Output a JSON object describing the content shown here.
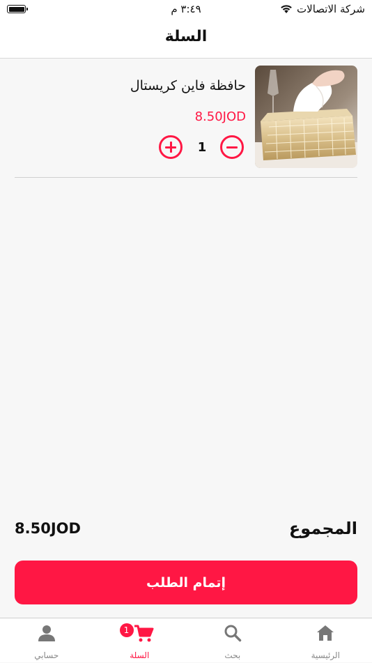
{
  "status_bar": {
    "carrier": "شركة الاتصالات",
    "time": "٣:٤٩ م"
  },
  "header": {
    "title": "السلة"
  },
  "cart": {
    "items": [
      {
        "name": "حافظة فاين كريستال",
        "price": "8.50JOD",
        "quantity": "1"
      }
    ]
  },
  "summary": {
    "total_label": "المجموع",
    "total_value": "8.50JOD"
  },
  "checkout": {
    "label": "إتمام الطلب"
  },
  "tab_bar": {
    "items": [
      {
        "label": "الرئيسية",
        "icon": "home-icon"
      },
      {
        "label": "بحث",
        "icon": "search-icon"
      },
      {
        "label": "السلة",
        "icon": "cart-icon",
        "badge": "1"
      },
      {
        "label": "حسابي",
        "icon": "person-icon"
      }
    ]
  },
  "colors": {
    "accent": "#ff1744",
    "background": "#f7f7f7"
  }
}
